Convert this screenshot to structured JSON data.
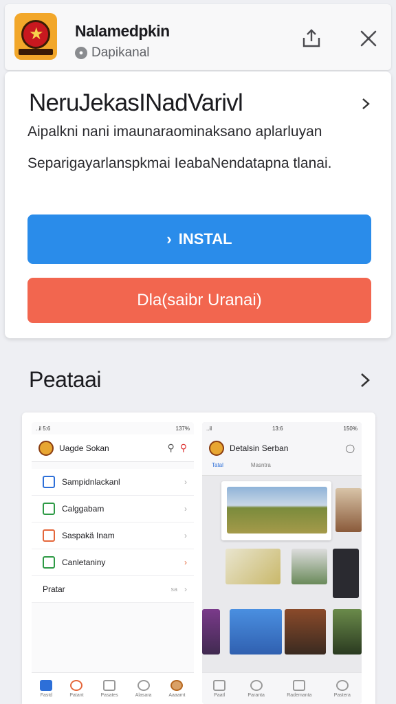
{
  "header": {
    "app_title": "Nalamedpkin",
    "app_subtitle": "Dapikanal",
    "share_icon": "share-icon",
    "close_icon": "close-icon"
  },
  "card": {
    "title": "NeruJekasINadVarivl",
    "description_line1": "Aipalkni nani imaunaraominaksano aplarluyan",
    "description_line2": "Separigayarlanspkmai IeabaNendatapna tlanai.",
    "install_label": "INSTAL",
    "second_label": "Dla(saibr Uranai)"
  },
  "section": {
    "title": "Peataai"
  },
  "screenshot1": {
    "status_left": "..il 5:6",
    "status_right": "137%",
    "app_title": "Uagde Sokan",
    "items": [
      {
        "label": "Sampidnlackanl",
        "color": "#2d6fd8"
      },
      {
        "label": "Calggabam",
        "color": "#2d9a45"
      },
      {
        "label": "Saspakä Inam",
        "color": "#e4663a"
      },
      {
        "label": "Canletaniny",
        "color": "#2d9a45"
      }
    ],
    "last_item": "Pratar",
    "last_item_right": "sa",
    "tabs": [
      "Fastd",
      "Patant",
      "Pasates",
      "Alasara",
      "Aaaamt"
    ]
  },
  "screenshot2": {
    "status_time": "13:6",
    "status_right": "150%",
    "app_title": "Detalsin Serban",
    "tabs": [
      "Tatal",
      "Masntra"
    ],
    "bottom_tabs": [
      "Paatl",
      "Paranta",
      "Rademanta",
      "Pastera"
    ]
  },
  "colors": {
    "install": "#2a8cea",
    "secondary": "#f2664f",
    "app_icon": "#f2a72a"
  }
}
